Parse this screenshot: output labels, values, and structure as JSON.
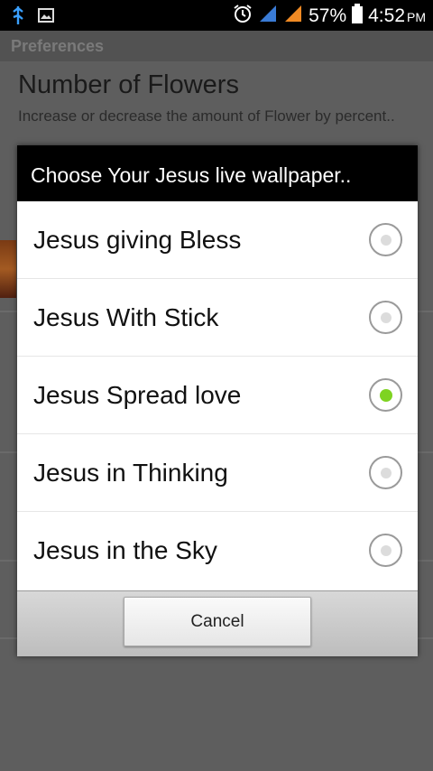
{
  "status_bar": {
    "battery_percent": "57%",
    "time": "4:52",
    "ampm": "PM",
    "icons": [
      "usb-icon",
      "image-icon",
      "alarm-icon",
      "signal-icon",
      "signal-icon",
      "battery-icon"
    ]
  },
  "background": {
    "header_title": "Preferences",
    "setting_title": "Number of Flowers",
    "setting_description": "Increase or decrease the amount of Flower by percent.."
  },
  "dialog": {
    "title": "Choose Your Jesus live wallpaper..",
    "options": [
      {
        "label": "Jesus giving Bless",
        "checked": false
      },
      {
        "label": "Jesus With Stick",
        "checked": false
      },
      {
        "label": "Jesus Spread love",
        "checked": true
      },
      {
        "label": "Jesus in Thinking",
        "checked": false
      },
      {
        "label": "Jesus in the Sky",
        "checked": false
      }
    ],
    "cancel_label": "Cancel"
  },
  "colors": {
    "radio_selected": "#7ed321",
    "dialog_title_bg": "#000000",
    "scrim": "#5e5e5e"
  }
}
